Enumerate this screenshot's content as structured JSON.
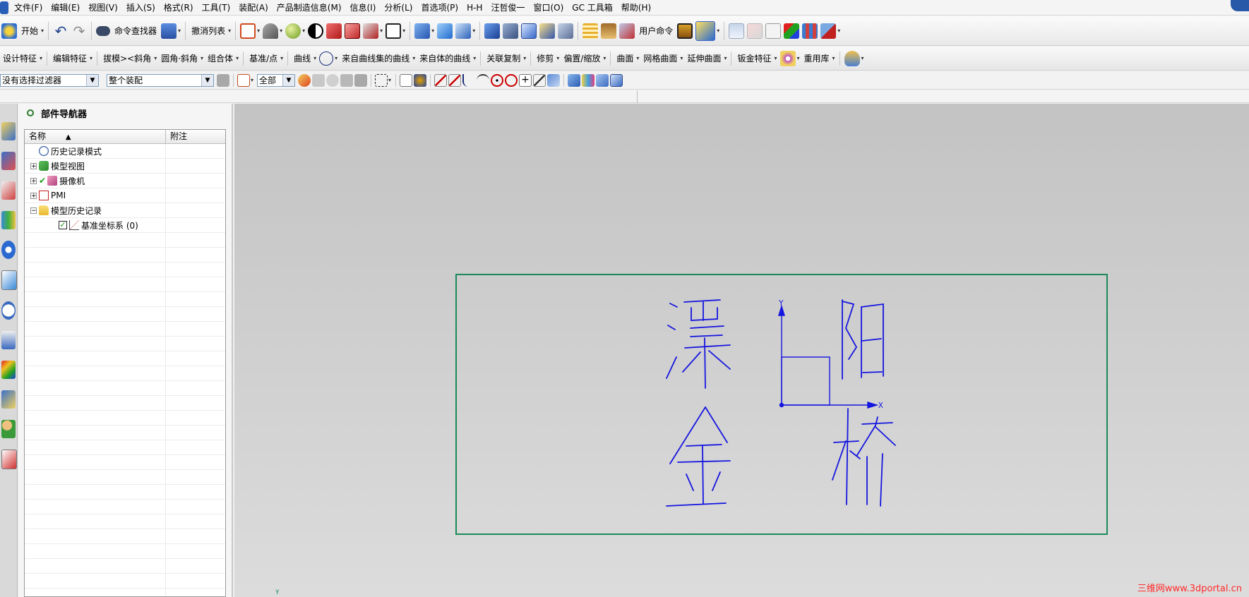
{
  "menu": [
    "文件(F)",
    "编辑(E)",
    "视图(V)",
    "插入(S)",
    "格式(R)",
    "工具(T)",
    "装配(A)",
    "产品制造信息(M)",
    "信息(I)",
    "分析(L)",
    "首选项(P)",
    "H-H",
    "汪哲俊一",
    "窗口(O)",
    "GC 工具箱",
    "帮助(H)"
  ],
  "toolbar_standard": {
    "start": "开始",
    "command_finder": "命令查找器",
    "undo_list": "撤消列表",
    "user_command": "用户命令"
  },
  "toolbar_features": [
    "设计特征",
    "编辑特征",
    "拔模><斜角",
    "圆角·斜角",
    "组合体",
    "基准/点",
    "曲线",
    "来自曲线集的曲线",
    "来自体的曲线",
    "关联复制",
    "修剪",
    "偏置/缩放",
    "曲面",
    "网格曲面",
    "延伸曲面",
    "钣金特征",
    "重用库"
  ],
  "selection_bar": {
    "filter": "没有选择过滤器",
    "scope": "整个装配",
    "type": "全部"
  },
  "navigator": {
    "title": "部件导航器",
    "col_name": "名称",
    "col_note": "附注",
    "rows": [
      {
        "label": "历史记录模式",
        "icon": "clock-icon",
        "level": 0,
        "expander": ""
      },
      {
        "label": "模型视图",
        "icon": "model-view-icon",
        "level": 0,
        "expander": "+"
      },
      {
        "label": "摄像机",
        "icon": "camera-icon",
        "level": 0,
        "expander": "+"
      },
      {
        "label": "PMI",
        "icon": "pmi-icon",
        "level": 0,
        "expander": "+"
      },
      {
        "label": "模型历史记录",
        "icon": "folder-icon",
        "level": 0,
        "expander": "−"
      },
      {
        "label": "基准坐标系 (0)",
        "icon": "datum-csys-icon",
        "level": 1,
        "expander": ""
      }
    ]
  },
  "viewport": {
    "axis_y": "Y",
    "axis_x": "X",
    "corner_axis": "Y",
    "frame_color": "#1a8a5a",
    "sketch_color": "#1515e0"
  },
  "watermark": "三维网www.3dportal.cn"
}
